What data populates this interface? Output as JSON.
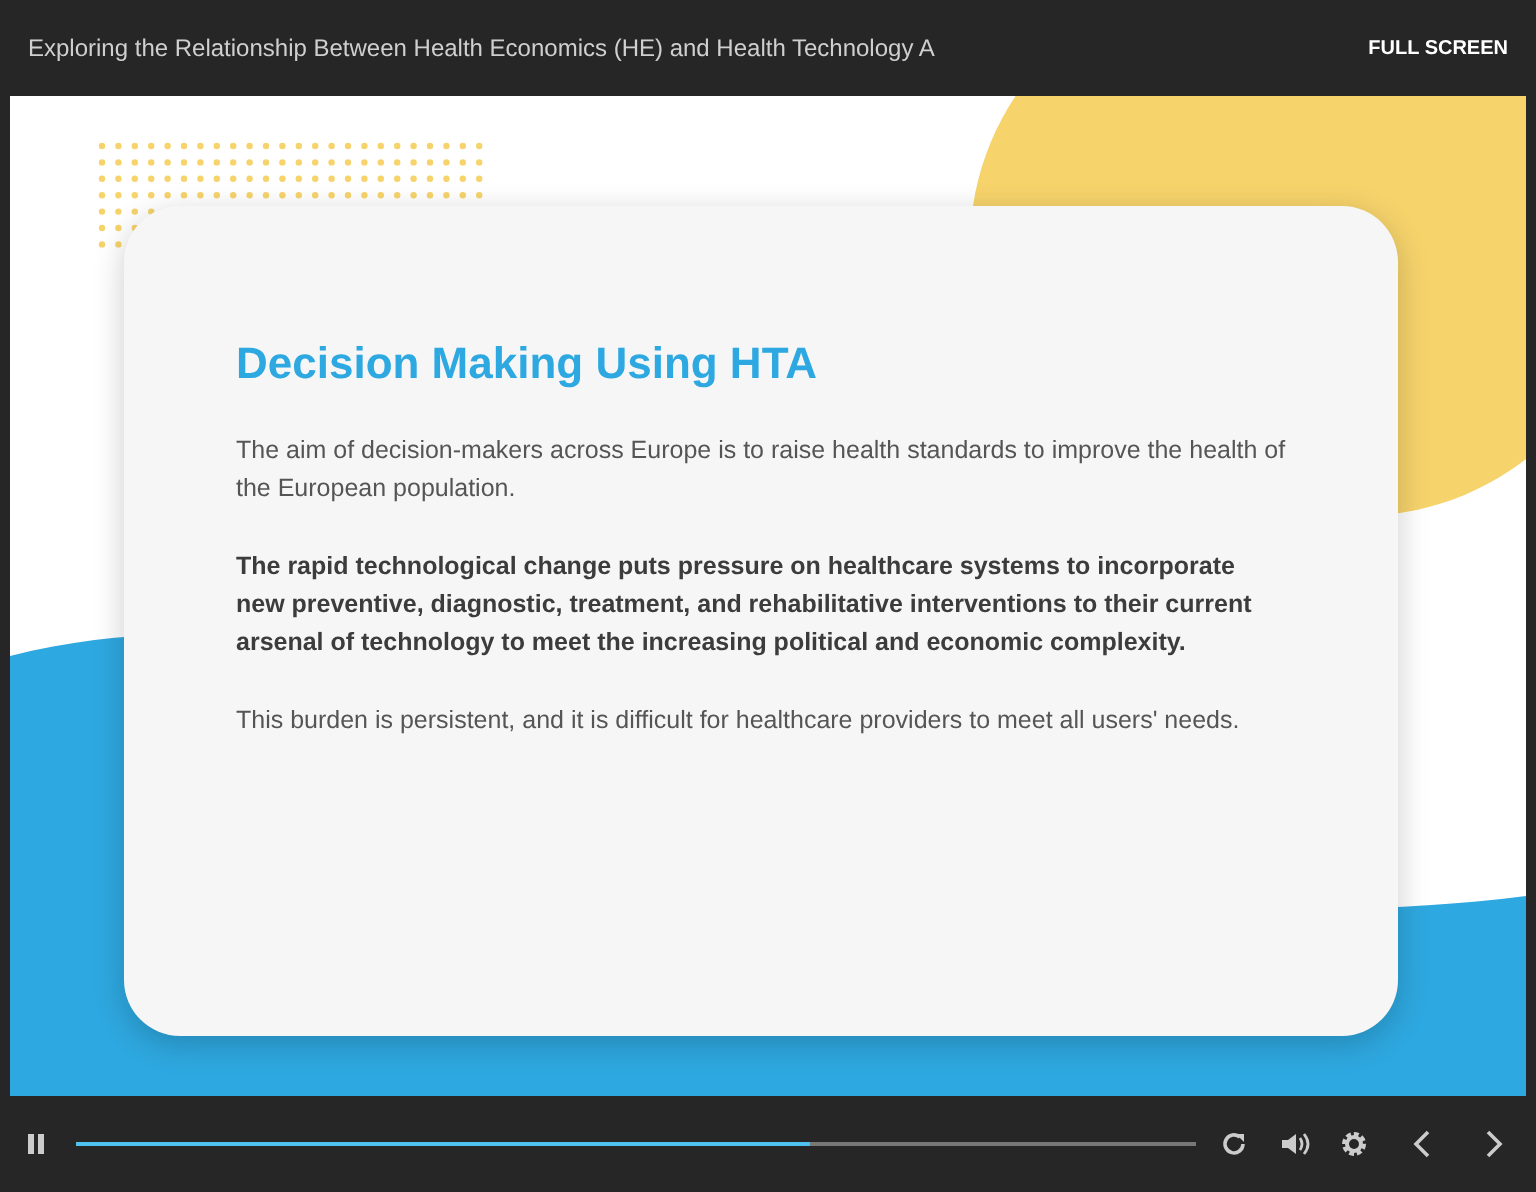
{
  "window": {
    "title": "Exploring the Relationship Between Health Economics (HE) and Health Technology A",
    "full_screen": "FULL SCREEN"
  },
  "slide": {
    "heading": "Decision Making Using HTA",
    "paragraphs": [
      {
        "text": "The aim of decision-makers across Europe is to raise health standards to improve the health of the European population.",
        "bold": false
      },
      {
        "text": "The rapid technological change puts pressure on healthcare systems to incorporate new preventive, diagnostic, treatment, and rehabilitative interventions to their current arsenal of technology to meet the increasing political and economic complexity.",
        "bold": true
      },
      {
        "text": "This burden is persistent, and it is difficult for healthcare providers to meet all users' needs.",
        "bold": false
      }
    ]
  },
  "player": {
    "playing": true,
    "progress": {
      "level": 0.655
    }
  }
}
